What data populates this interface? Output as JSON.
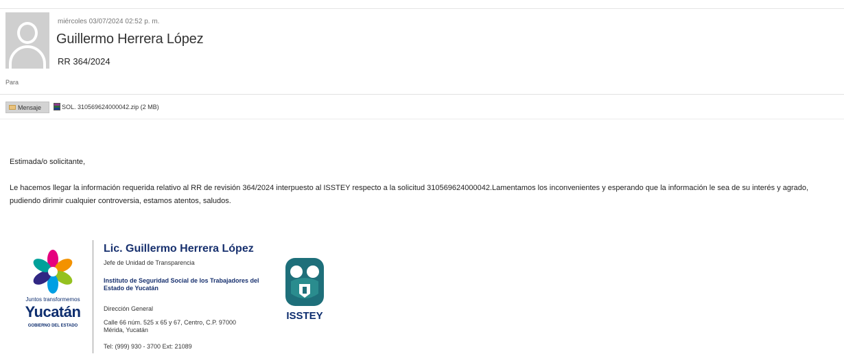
{
  "header": {
    "date": "miércoles 03/07/2024 02:52 p. m.",
    "sender_name": "Guillermo Herrera López",
    "subject": "RR 364/2024",
    "to_label": "Para"
  },
  "attachments": {
    "message_tab": "Mensaje",
    "file": "SOL. 310569624000042.zip (2 MB)"
  },
  "body": {
    "greeting": "Estimada/o  solicitante,",
    "paragraph": "Le hacemos llegar la información requerida relativo al RR de revisión 364/2024 interpuesto al ISSTEY respecto a la solicitud  310569624000042.Lamentamos los inconvenientes y esperando que la información le sea de su interés y agrado, pudiendo dirimir cualquier controversia,  estamos atentos, saludos."
  },
  "signature": {
    "name": "Lic. Guillermo Herrera López",
    "role": "Jefe de Unidad de Transparencia",
    "institution": "Instituto de Seguridad Social de los Trabajadores del Estado de Yucatán",
    "department": "Dirección General",
    "address_line1": "Calle 66 núm. 525 x 65 y 67, Centro, C.P. 97000",
    "address_line2": "Mérida, Yucatán",
    "phone": "Tel: (999) 930 - 3700 Ext: 21089"
  },
  "logos": {
    "yucatan_tagline": "Juntos transformemos",
    "yucatan_word": "Yucatán",
    "yucatan_gov": "GOBIERNO DEL ESTADO",
    "isstey_word": "ISSTEY"
  },
  "colors": {
    "brand_navy": "#0d2d6e",
    "isstey_teal": "#1e6f7a"
  }
}
